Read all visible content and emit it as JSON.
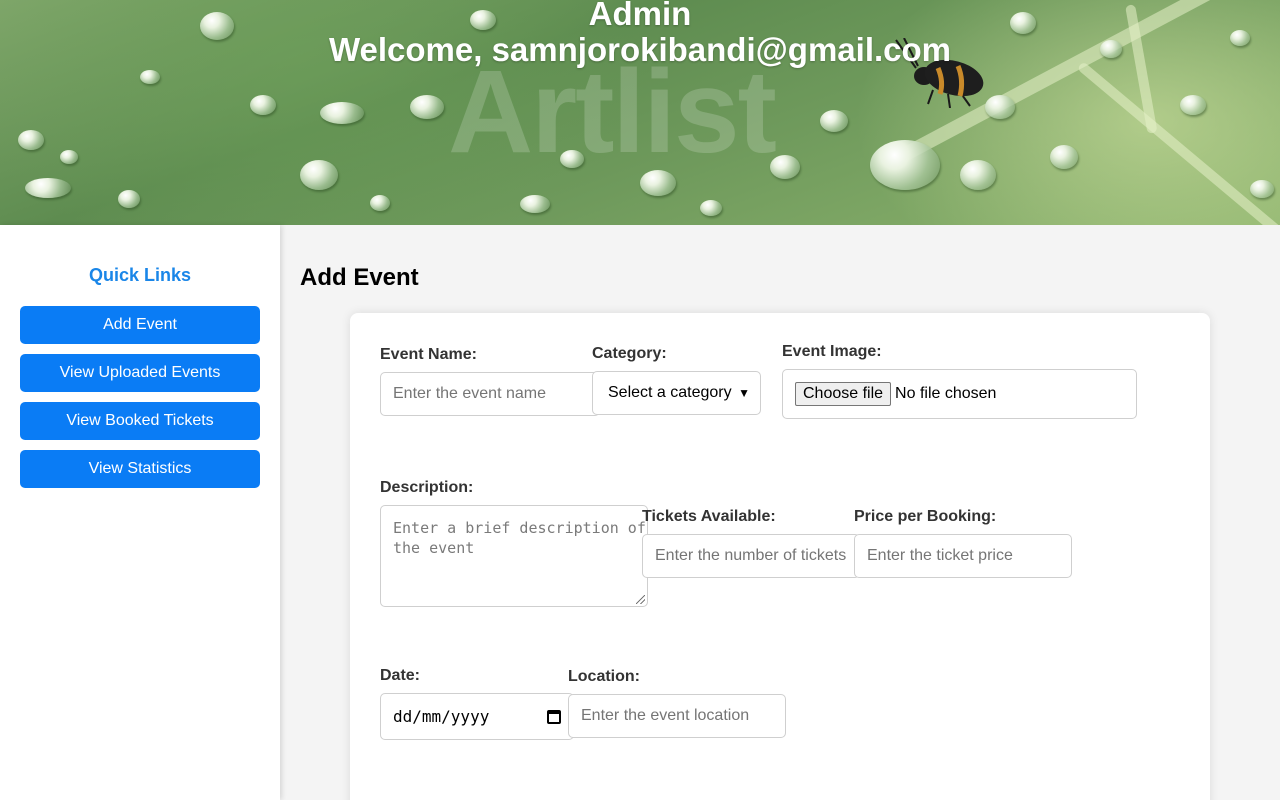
{
  "header": {
    "title": "Admin",
    "welcome": "Welcome, samnjorokibandi@gmail.com",
    "watermark": "Artlist"
  },
  "sidebar": {
    "heading": "Quick Links",
    "links": [
      {
        "label": "Add Event"
      },
      {
        "label": "View Uploaded Events"
      },
      {
        "label": "View Booked Tickets"
      },
      {
        "label": "View Statistics"
      }
    ]
  },
  "main": {
    "title": "Add Event",
    "form": {
      "event_name": {
        "label": "Event Name:",
        "placeholder": "Enter the event name"
      },
      "category": {
        "label": "Category:",
        "selected": "Select a category"
      },
      "event_image": {
        "label": "Event Image:",
        "button": "Choose file",
        "status": "No file chosen"
      },
      "description": {
        "label": "Description:",
        "placeholder": "Enter a brief description of the event"
      },
      "tickets_available": {
        "label": "Tickets Available:",
        "placeholder": "Enter the number of tickets"
      },
      "price": {
        "label": "Price per Booking:",
        "placeholder": "Enter the ticket price"
      },
      "date": {
        "label": "Date:",
        "value": "dd/mm/yyyy"
      },
      "location": {
        "label": "Location:",
        "placeholder": "Enter the event location"
      }
    }
  },
  "colors": {
    "accent": "#0a7cf5",
    "heading_accent": "#1a86e8",
    "background": "#f4f4f4"
  }
}
